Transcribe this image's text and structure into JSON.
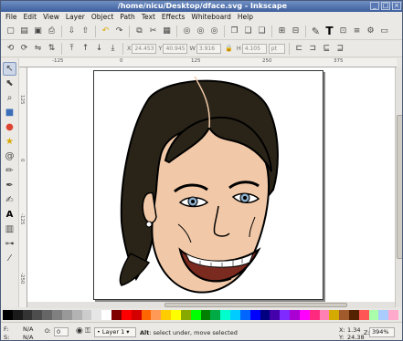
{
  "window": {
    "title": "/home/nicu/Desktop/dface.svg - Inkscape"
  },
  "menu": [
    "File",
    "Edit",
    "View",
    "Layer",
    "Object",
    "Path",
    "Text",
    "Effects",
    "Whiteboard",
    "Help"
  ],
  "toolbar1_icons": [
    "new-icon",
    "open-icon",
    "save-icon",
    "print-icon",
    "import-icon",
    "export-icon",
    "undo-icon",
    "redo-icon",
    "copy-icon",
    "cut-icon",
    "paste-icon",
    "zoom-selection-icon",
    "zoom-drawing-icon",
    "zoom-page-icon",
    "duplicate-icon",
    "clone-icon",
    "unlink-clone-icon",
    "group-icon",
    "ungroup-icon",
    "fill-stroke-icon",
    "text-font-icon",
    "xml-editor-icon",
    "align-icon",
    "preferences-icon",
    "document-properties-icon"
  ],
  "toolbar2": {
    "x_value": "24.453",
    "y_value": "40.945",
    "w_value": "3.916",
    "h_value": "4.105",
    "unit": "pt"
  },
  "left_tools": [
    "selector-tool",
    "node-tool",
    "zoom-tool",
    "rectangle-tool",
    "circle-tool",
    "star-tool",
    "spiral-tool",
    "pencil-tool",
    "pen-tool",
    "calligraphy-tool",
    "text-tool",
    "gradient-tool",
    "connector-tool",
    "dropper-tool"
  ],
  "ruler": {
    "top_labels": [
      "-125",
      "0",
      "125",
      "250",
      "375"
    ],
    "left_labels": [
      "125",
      "0",
      "-125",
      "-250"
    ]
  },
  "palette": [
    "#000000",
    "#1a1a1a",
    "#333333",
    "#4d4d4d",
    "#666666",
    "#808080",
    "#999999",
    "#b3b3b3",
    "#cccccc",
    "#e6e6e6",
    "#ffffff",
    "#800000",
    "#ff0000",
    "#d40000",
    "#ff6600",
    "#ff9955",
    "#ffcc00",
    "#ffff00",
    "#88aa00",
    "#00ff00",
    "#008000",
    "#00aa44",
    "#00ffcc",
    "#00ccff",
    "#0066ff",
    "#0000ff",
    "#000080",
    "#4400aa",
    "#7f2aff",
    "#aa00d4",
    "#ff00ff",
    "#ff2a7f",
    "#ff80b2",
    "#d4aa00",
    "#a05a2c",
    "#552200",
    "#ff5555",
    "#aaffaa",
    "#aaccff",
    "#ffaacc"
  ],
  "status": {
    "fill_label": "F:",
    "fill_value": "N/A",
    "stroke_label": "S:",
    "stroke_value": "N/A",
    "opacity": "0",
    "layer": "Layer 1",
    "message_key": "Alt",
    "message_text": ": select under, move selected",
    "x_label": "X:",
    "x_value": "1.34",
    "y_label": "Y:",
    "y_value": "24.38",
    "z_label": "Z:",
    "zoom": "394%"
  }
}
